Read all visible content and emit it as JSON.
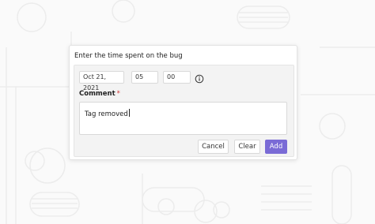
{
  "dialog": {
    "title": "Enter the time spent on the bug",
    "date_value": "Oct 21, 2021",
    "hours_value": "05",
    "minutes_value": "00",
    "comment_label": "Comment",
    "required_mark": "*",
    "comment_value": "Tag removed",
    "cancel_label": "Cancel",
    "clear_label": "Clear",
    "add_label": "Add"
  },
  "icons": {
    "info": "info-circle-icon"
  },
  "colors": {
    "accent": "#7a6bd6",
    "required": "#d13a3a",
    "background": "#fafafa"
  }
}
